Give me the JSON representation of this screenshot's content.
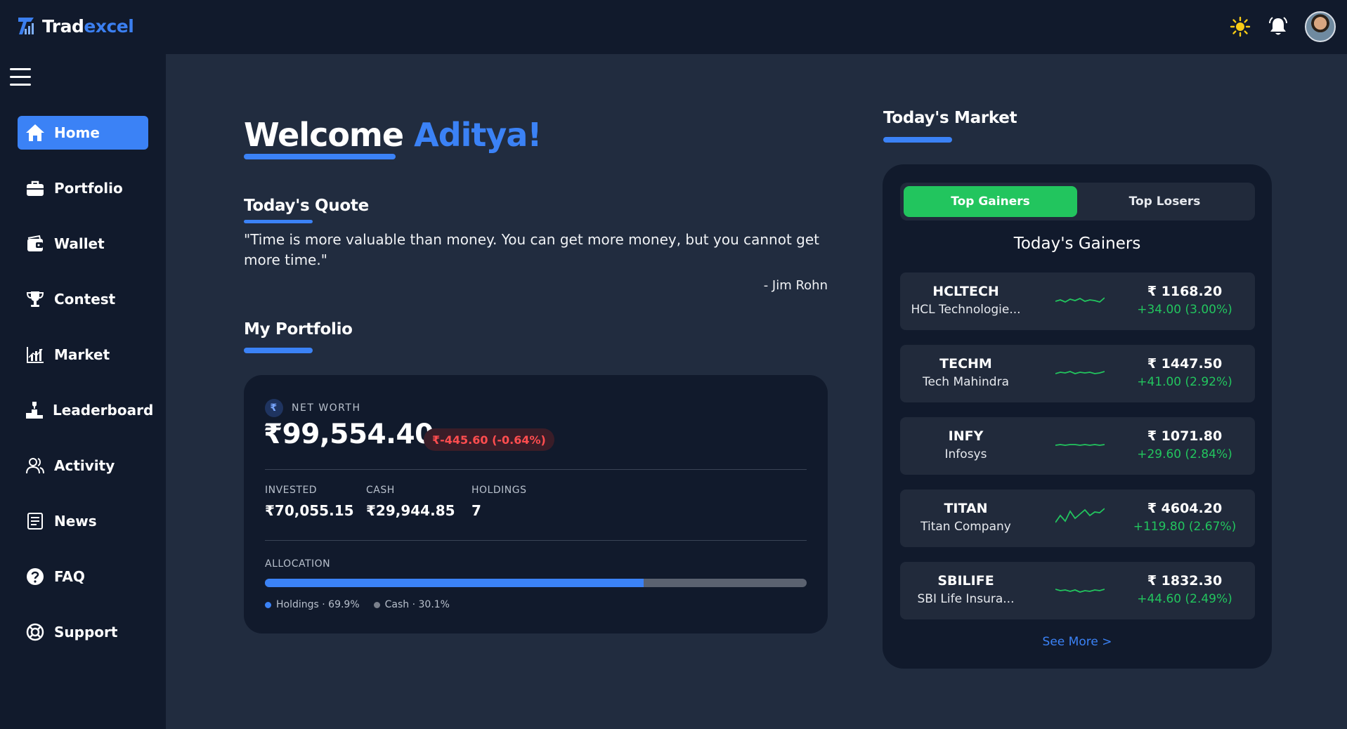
{
  "brand": {
    "part1": "Trad",
    "part2": "excel",
    "accent": "#3b82f6"
  },
  "topbar": {
    "theme_icon": "sun-icon",
    "notification_icon": "bell-icon",
    "avatar": "user-avatar"
  },
  "sidebar": {
    "items": [
      {
        "label": "Home",
        "icon": "home-icon",
        "active": true
      },
      {
        "label": "Portfolio",
        "icon": "briefcase-icon"
      },
      {
        "label": "Wallet",
        "icon": "wallet-icon"
      },
      {
        "label": "Contest",
        "icon": "trophy-icon"
      },
      {
        "label": "Market",
        "icon": "market-chart-icon"
      },
      {
        "label": "Leaderboard",
        "icon": "podium-icon"
      },
      {
        "label": "Activity",
        "icon": "users-icon"
      },
      {
        "label": "News",
        "icon": "newspaper-icon"
      },
      {
        "label": "FAQ",
        "icon": "question-icon"
      },
      {
        "label": "Support",
        "icon": "lifebuoy-icon"
      }
    ]
  },
  "welcome": {
    "greeting": "Welcome",
    "name": "Aditya!"
  },
  "quote": {
    "heading": "Today's Quote",
    "text": "\"Time is more valuable than money. You can get more money, but you cannot get more time.\"",
    "author": "- Jim Rohn"
  },
  "portfolio": {
    "heading": "My Portfolio",
    "currency_symbol": "₹",
    "net_worth_label": "NET WORTH",
    "net_worth": "₹99,554.40",
    "change": "₹-445.60 (-0.64%)",
    "invested_label": "INVESTED",
    "invested": "₹70,055.15",
    "cash_label": "CASH",
    "cash": "₹29,944.85",
    "holdings_label": "HOLDINGS",
    "holdings": "7",
    "allocation_label": "ALLOCATION",
    "allocation_holdings_pct": 69.9,
    "legend_holdings": "Holdings · 69.9%",
    "legend_cash": "Cash · 30.1%",
    "colors": {
      "holdings": "#3b82f6",
      "cash": "#5b6270",
      "negative": "#ff4d4f"
    }
  },
  "market": {
    "heading": "Today's Market",
    "tab_gainers": "Top Gainers",
    "tab_losers": "Top Losers",
    "list_title": "Today's Gainers",
    "see_more": "See More >",
    "positive_color": "#22c55e",
    "stocks": [
      {
        "symbol": "HCLTECH",
        "name": "HCL Technologie...",
        "price": "₹ 1168.20",
        "change": "+34.00 (3.00%)",
        "spark": [
          18,
          16,
          19,
          15,
          17,
          14,
          18,
          16,
          17,
          19,
          13
        ]
      },
      {
        "symbol": "TECHM",
        "name": "Tech Mahindra",
        "price": "₹ 1447.50",
        "change": "+41.00 (2.92%)",
        "spark": [
          18,
          16,
          17,
          15,
          18,
          16,
          17,
          16,
          18,
          17,
          15
        ]
      },
      {
        "symbol": "INFY",
        "name": "Infosys",
        "price": "₹ 1071.80",
        "change": "+29.60 (2.84%)",
        "spark": [
          17,
          16,
          17,
          16,
          16,
          17,
          16,
          17,
          16,
          17,
          16
        ]
      },
      {
        "symbol": "TITAN",
        "name": "Titan Company",
        "price": "₹ 4604.20",
        "change": "+119.80 (2.67%)",
        "spark": [
          24,
          14,
          22,
          8,
          18,
          12,
          6,
          14,
          9,
          10,
          4
        ]
      },
      {
        "symbol": "SBILIFE",
        "name": "SBI Life Insura...",
        "price": "₹ 1832.30",
        "change": "+44.60 (2.49%)",
        "spark": [
          16,
          18,
          17,
          19,
          17,
          20,
          18,
          19,
          17,
          18,
          16
        ]
      }
    ]
  }
}
